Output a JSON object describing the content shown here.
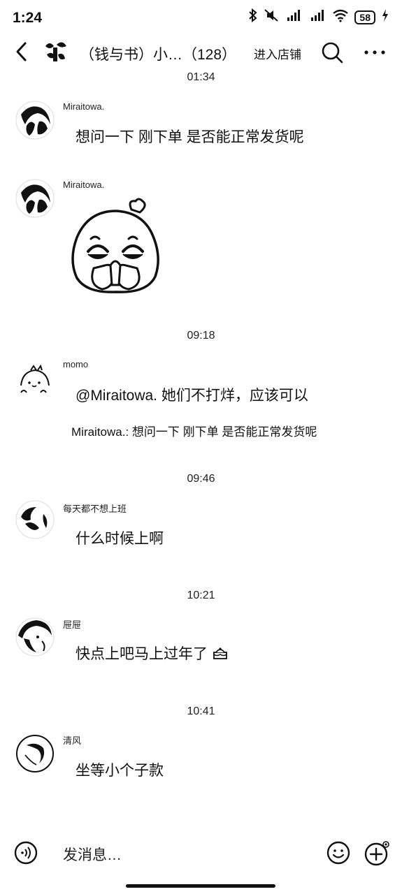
{
  "status_bar": {
    "time": "1:24",
    "battery": "58",
    "icons": [
      "bluetooth-icon",
      "mute-icon",
      "signal-icon",
      "signal-icon",
      "wifi-icon",
      "battery-icon",
      "charging-icon"
    ]
  },
  "header": {
    "title": "（钱与书）小…（128）",
    "shop_button": "进入店铺",
    "icons": [
      "back-icon",
      "search-icon",
      "more-icon"
    ]
  },
  "messages": [
    {
      "time": "01:34",
      "sender": "Miraitowa.",
      "text": "想问一下 刚下单 是否能正常发货呢"
    },
    {
      "sender": "Miraitowa.",
      "sticker": "praying-sticker"
    },
    {
      "time": "09:18",
      "sender": "momo",
      "text": "@Miraitowa. 她们不打烊，应该可以",
      "quote": "Miraitowa.: 想问一下 刚下单 是否能正常发货呢"
    },
    {
      "time": "09:46",
      "sender": "每天都不想上班",
      "text": "什么时候上啊"
    },
    {
      "time": "10:21",
      "sender": "屉屉",
      "text": "快点上吧马上过年了"
    },
    {
      "time": "10:41",
      "sender": "清风",
      "text": "坐等小个子款"
    }
  ],
  "input": {
    "placeholder": "发消息…",
    "icons": [
      "voice-icon",
      "emoji-icon",
      "plus-icon"
    ]
  },
  "colors": {
    "text": "#111111",
    "background": "#ffffff"
  }
}
